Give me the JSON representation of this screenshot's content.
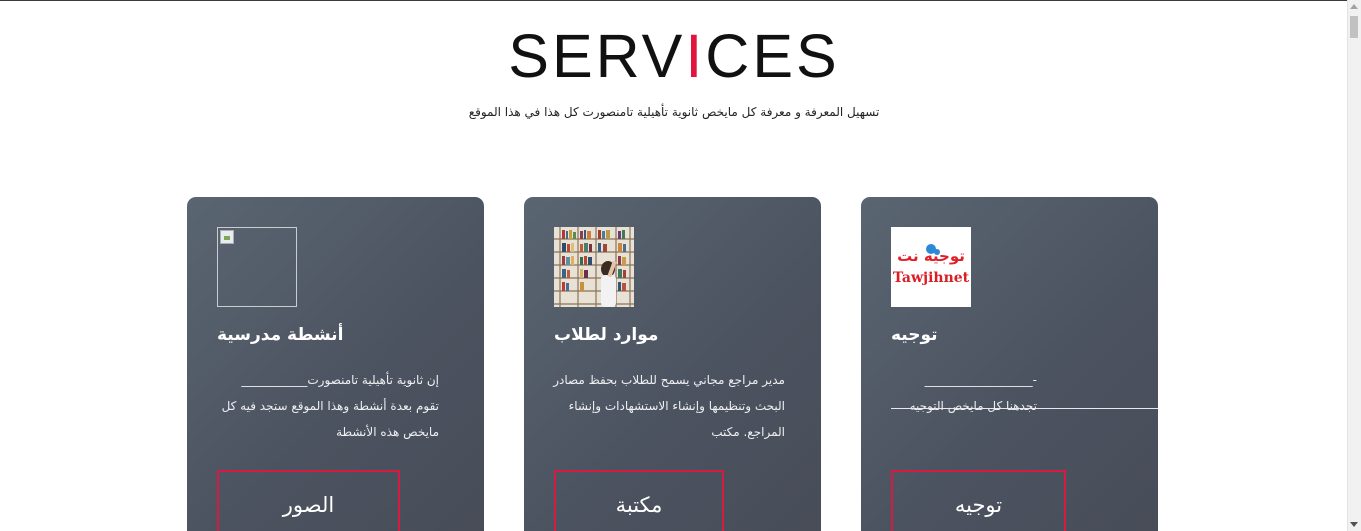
{
  "header": {
    "title_before": "SERV",
    "title_accent": "I",
    "title_after": "CES",
    "subtitle": "تسهيل المعرفة و معرفة كل مايخص ثانوية تأهيلية تامنصورت كل هذا في هذا الموقع",
    "accent_color": "#e0163f"
  },
  "cards": [
    {
      "title": "أنشطة مدرسية",
      "lines": [
        "إن ثانوية تأهيلية تامنصورت___________",
        "تقوم بعدة أنشطة وهذا الموقع ستجد فيه كل",
        "مايخص هذه الأنشطة"
      ],
      "button": "الصور",
      "image": "broken-image-icon"
    },
    {
      "title": "موارد لطلاب",
      "lines": [
        "مدير مراجع مجاني يسمح للطلاب بحفظ مصادر",
        "البحث وتنظيمها وإنشاء الاستشهادات وإنشاء",
        "المراجع. مكتب"
      ],
      "button": "مكتبة",
      "image": "library-photo"
    },
    {
      "title": "توجيه",
      "lines": [
        "-__________________",
        "",
        "تجدهنا كل مايخص التوجيه"
      ],
      "button": "توجيه",
      "image": "tawjihnet-logo",
      "logo_arabic": "توجيه نت",
      "logo_latin": "Tawjihnet"
    }
  ]
}
